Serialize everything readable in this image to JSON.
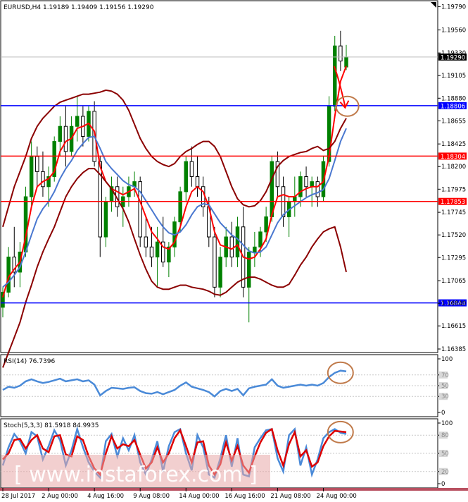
{
  "chart_data": [
    {
      "type": "candlestick",
      "title": "EURUSD,H4  1.19189 1.19409 1.19156 1.19290",
      "symbol": "EURUSD,H4",
      "ohlc": {
        "open": 1.19189,
        "high": 1.19409,
        "low": 1.19156,
        "close": 1.1929
      },
      "ylim": [
        1.1635,
        1.1985
      ],
      "y_ticks": [
        "1.19790",
        "1.19560",
        "1.19330",
        "1.19105",
        "1.18880",
        "1.18655",
        "1.18425",
        "1.18200",
        "1.17975",
        "1.17745",
        "1.17520",
        "1.17295",
        "1.17065",
        "1.16840",
        "1.16615",
        "1.16385"
      ],
      "current_price": {
        "value": 1.1929,
        "label": "1.19290",
        "color": "#000000"
      },
      "levels": [
        {
          "value": 1.18806,
          "label": "1.18806",
          "color": "#0000ff"
        },
        {
          "value": 1.18304,
          "label": "1.18304",
          "color": "#ff0000"
        },
        {
          "value": 1.17853,
          "label": "1.17853",
          "color": "#ff0000"
        },
        {
          "value": 1.16844,
          "label": "1.16844",
          "color": "#0000ff"
        }
      ],
      "x_labels": [
        "28 Jul 2017",
        "2 Aug 00:00",
        "4 Aug 16:00",
        "9 Aug 08:00",
        "14 Aug 00:00",
        "16 Aug 16:00",
        "21 Aug 08:00",
        "24 Aug 00:00"
      ],
      "series": [
        {
          "kind": "candles",
          "color_up": "#008000",
          "color_down": "#000000",
          "values": [
            [
              1.168,
              1.17,
              1.167,
              1.1695
            ],
            [
              1.1695,
              1.174,
              1.169,
              1.173
            ],
            [
              1.173,
              1.176,
              1.17,
              1.1715
            ],
            [
              1.1715,
              1.1745,
              1.17,
              1.1735
            ],
            [
              1.1735,
              1.18,
              1.173,
              1.179
            ],
            [
              1.179,
              1.1845,
              1.178,
              1.183
            ],
            [
              1.183,
              1.184,
              1.18,
              1.1815
            ],
            [
              1.1815,
              1.1835,
              1.179,
              1.18
            ],
            [
              1.18,
              1.182,
              1.178,
              1.181
            ],
            [
              1.181,
              1.185,
              1.1805,
              1.1845
            ],
            [
              1.1845,
              1.187,
              1.183,
              1.186
            ],
            [
              1.186,
              1.188,
              1.182,
              1.1835
            ],
            [
              1.1835,
              1.187,
              1.183,
              1.186
            ],
            [
              1.186,
              1.189,
              1.1845,
              1.187
            ],
            [
              1.187,
              1.188,
              1.184,
              1.185
            ],
            [
              1.185,
              1.188,
              1.1845,
              1.1875
            ],
            [
              1.1875,
              1.1885,
              1.182,
              1.1825
            ],
            [
              1.1825,
              1.183,
              1.173,
              1.175
            ],
            [
              1.175,
              1.179,
              1.174,
              1.1785
            ],
            [
              1.1785,
              1.181,
              1.1775,
              1.18
            ],
            [
              1.18,
              1.181,
              1.177,
              1.178
            ],
            [
              1.178,
              1.18,
              1.176,
              1.179
            ],
            [
              1.179,
              1.181,
              1.178,
              1.18
            ],
            [
              1.18,
              1.1815,
              1.179,
              1.1805
            ],
            [
              1.1805,
              1.181,
              1.174,
              1.175
            ],
            [
              1.175,
              1.177,
              1.173,
              1.174
            ],
            [
              1.174,
              1.176,
              1.172,
              1.173
            ],
            [
              1.173,
              1.176,
              1.17,
              1.1745
            ],
            [
              1.1745,
              1.177,
              1.172,
              1.1725
            ],
            [
              1.1725,
              1.1745,
              1.171,
              1.174
            ],
            [
              1.174,
              1.177,
              1.173,
              1.1765
            ],
            [
              1.1765,
              1.18,
              1.1755,
              1.1795
            ],
            [
              1.1795,
              1.183,
              1.1785,
              1.1825
            ],
            [
              1.1825,
              1.184,
              1.18,
              1.181
            ],
            [
              1.181,
              1.183,
              1.179,
              1.18
            ],
            [
              1.18,
              1.181,
              1.177,
              1.178
            ],
            [
              1.178,
              1.179,
              1.174,
              1.175
            ],
            [
              1.175,
              1.176,
              1.169,
              1.17
            ],
            [
              1.17,
              1.174,
              1.169,
              1.173
            ],
            [
              1.173,
              1.176,
              1.172,
              1.175
            ],
            [
              1.175,
              1.1765,
              1.172,
              1.173
            ],
            [
              1.173,
              1.177,
              1.172,
              1.176
            ],
            [
              1.176,
              1.178,
              1.169,
              1.17
            ],
            [
              1.17,
              1.174,
              1.1665,
              1.1735
            ],
            [
              1.1735,
              1.1755,
              1.172,
              1.174
            ],
            [
              1.174,
              1.176,
              1.173,
              1.1755
            ],
            [
              1.1755,
              1.178,
              1.1745,
              1.177
            ],
            [
              1.177,
              1.183,
              1.1765,
              1.1825
            ],
            [
              1.1825,
              1.1835,
              1.179,
              1.18
            ],
            [
              1.18,
              1.181,
              1.176,
              1.177
            ],
            [
              1.177,
              1.179,
              1.175,
              1.1785
            ],
            [
              1.1785,
              1.181,
              1.177,
              1.179
            ],
            [
              1.179,
              1.1815,
              1.178,
              1.181
            ],
            [
              1.181,
              1.182,
              1.179,
              1.18
            ],
            [
              1.18,
              1.181,
              1.178,
              1.1805
            ],
            [
              1.1805,
              1.181,
              1.178,
              1.179
            ],
            [
              1.179,
              1.183,
              1.1785,
              1.1825
            ],
            [
              1.1825,
              1.189,
              1.182,
              1.188
            ],
            [
              1.188,
              1.195,
              1.1875,
              1.194
            ],
            [
              1.194,
              1.1955,
              1.1915,
              1.1925
            ],
            [
              1.1919,
              1.1941,
              1.1916,
              1.1929
            ]
          ]
        },
        {
          "kind": "line",
          "color": "#ff0000",
          "role": "fast moving average",
          "values": [
            1.169,
            1.171,
            1.1718,
            1.1725,
            1.175,
            1.178,
            1.18,
            1.1805,
            1.1808,
            1.1815,
            1.1835,
            1.1845,
            1.1848,
            1.1858,
            1.186,
            1.1863,
            1.1855,
            1.182,
            1.1805,
            1.1798,
            1.1795,
            1.1792,
            1.1795,
            1.1798,
            1.1785,
            1.177,
            1.1755,
            1.1748,
            1.174,
            1.1738,
            1.1745,
            1.176,
            1.178,
            1.1795,
            1.18,
            1.1795,
            1.178,
            1.1755,
            1.1742,
            1.174,
            1.1738,
            1.1742,
            1.173,
            1.1728,
            1.173,
            1.1738,
            1.1748,
            1.1772,
            1.179,
            1.1792,
            1.179,
            1.179,
            1.1795,
            1.1798,
            1.18,
            1.18,
            1.1805,
            1.183,
            1.187,
            1.1905,
            1.192
          ]
        },
        {
          "kind": "line",
          "color": "#4a78d0",
          "role": "slow moving average",
          "values": [
            1.17,
            1.1705,
            1.1712,
            1.172,
            1.1735,
            1.1752,
            1.1768,
            1.1778,
            1.1785,
            1.1795,
            1.1808,
            1.1818,
            1.1826,
            1.1836,
            1.1843,
            1.1849,
            1.185,
            1.1838,
            1.1825,
            1.1818,
            1.1812,
            1.1806,
            1.1802,
            1.18,
            1.1795,
            1.1786,
            1.1777,
            1.1768,
            1.176,
            1.1754,
            1.1752,
            1.1755,
            1.1762,
            1.1772,
            1.178,
            1.1783,
            1.1782,
            1.1773,
            1.1764,
            1.1758,
            1.1752,
            1.1748,
            1.1742,
            1.1736,
            1.1734,
            1.1735,
            1.174,
            1.1752,
            1.1764,
            1.1772,
            1.1777,
            1.1781,
            1.1785,
            1.1789,
            1.1792,
            1.1794,
            1.1797,
            1.1808,
            1.1826,
            1.1845,
            1.1858
          ]
        },
        {
          "kind": "line",
          "color": "#8b0000",
          "role": "upper band",
          "values": [
            1.176,
            1.178,
            1.18,
            1.1815,
            1.183,
            1.1848,
            1.186,
            1.1868,
            1.1874,
            1.188,
            1.1884,
            1.1886,
            1.1888,
            1.189,
            1.1892,
            1.1892,
            1.1893,
            1.1894,
            1.1896,
            1.1895,
            1.1892,
            1.1886,
            1.1876,
            1.1862,
            1.1848,
            1.1838,
            1.183,
            1.1825,
            1.1822,
            1.182,
            1.1823,
            1.183,
            1.1835,
            1.1838,
            1.1842,
            1.1845,
            1.1845,
            1.184,
            1.183,
            1.1815,
            1.18,
            1.1788,
            1.1782,
            1.178,
            1.1781,
            1.1786,
            1.1795,
            1.1808,
            1.182,
            1.1826,
            1.183,
            1.1832,
            1.1834,
            1.1835,
            1.1838,
            1.184,
            1.1836,
            1.1838,
            1.1845,
            1.1858,
            1.1868
          ]
        },
        {
          "kind": "line",
          "color": "#8b0000",
          "role": "lower band",
          "values": [
            1.162,
            1.1635,
            1.165,
            1.1665,
            1.1685,
            1.1702,
            1.172,
            1.1735,
            1.1748,
            1.176,
            1.1775,
            1.179,
            1.18,
            1.1808,
            1.1814,
            1.1818,
            1.1818,
            1.1812,
            1.1805,
            1.1798,
            1.1788,
            1.1778,
            1.1765,
            1.1748,
            1.1732,
            1.1718,
            1.1706,
            1.17,
            1.1698,
            1.1698,
            1.17,
            1.1702,
            1.1702,
            1.17,
            1.1699,
            1.1698,
            1.1696,
            1.1693,
            1.1692,
            1.1695,
            1.17,
            1.1705,
            1.1708,
            1.171,
            1.171,
            1.1708,
            1.1705,
            1.1702,
            1.17,
            1.17,
            1.1703,
            1.1712,
            1.1722,
            1.173,
            1.174,
            1.1748,
            1.1755,
            1.1758,
            1.176,
            1.174,
            1.1715
          ]
        }
      ],
      "annotations": [
        {
          "type": "arrow",
          "color": "#ff0000",
          "from": [
            58.6,
            1.191
          ],
          "to": [
            59.8,
            1.188
          ]
        },
        {
          "type": "circle",
          "color": "#c07a4a",
          "center": [
            60.2,
            1.188
          ]
        }
      ]
    },
    {
      "type": "line",
      "title": "RSI(14) 76.7396",
      "ylim": [
        0,
        100
      ],
      "y_ticks": [
        "100",
        "70",
        "50",
        "30",
        "0"
      ],
      "guide_lines": [
        70,
        50,
        30
      ],
      "series": [
        {
          "color": "#4a8ad8",
          "values": [
            42,
            48,
            46,
            50,
            58,
            62,
            58,
            55,
            57,
            60,
            63,
            58,
            60,
            62,
            58,
            60,
            52,
            32,
            40,
            46,
            45,
            44,
            46,
            47,
            40,
            36,
            35,
            38,
            34,
            38,
            42,
            50,
            56,
            48,
            45,
            42,
            38,
            30,
            40,
            44,
            40,
            44,
            32,
            45,
            48,
            50,
            52,
            62,
            50,
            46,
            48,
            50,
            52,
            50,
            52,
            50,
            55,
            66,
            74,
            78,
            76.7
          ]
        }
      ],
      "annotations": [
        {
          "type": "circle",
          "color": "#c07a4a",
          "center": [
            58.5,
            74
          ]
        }
      ]
    },
    {
      "type": "line",
      "title": "Stoch(5,3,3) 81.5918 84.9935",
      "ylim": [
        0,
        100
      ],
      "y_ticks": [
        "100",
        "80",
        "50",
        "20",
        "0"
      ],
      "guide_lines": [
        80,
        50,
        20
      ],
      "series": [
        {
          "color": "#4a8ad8",
          "role": "%K",
          "values": [
            30,
            60,
            82,
            70,
            50,
            85,
            78,
            40,
            62,
            88,
            72,
            30,
            55,
            90,
            60,
            35,
            20,
            10,
            70,
            82,
            45,
            75,
            55,
            80,
            35,
            15,
            40,
            70,
            20,
            62,
            85,
            90,
            50,
            22,
            80,
            60,
            15,
            10,
            42,
            80,
            28,
            75,
            15,
            12,
            60,
            75,
            88,
            90,
            42,
            20,
            80,
            90,
            30,
            60,
            15,
            40,
            75,
            85,
            90,
            84,
            82
          ]
        },
        {
          "color": "#dd0000",
          "role": "%D",
          "values": [
            40,
            50,
            72,
            74,
            58,
            72,
            80,
            58,
            52,
            78,
            80,
            48,
            45,
            78,
            72,
            45,
            25,
            15,
            50,
            78,
            58,
            65,
            62,
            72,
            48,
            25,
            35,
            60,
            35,
            50,
            75,
            88,
            62,
            35,
            68,
            70,
            30,
            15,
            32,
            68,
            38,
            62,
            30,
            18,
            45,
            68,
            84,
            90,
            55,
            30,
            65,
            85,
            45,
            55,
            28,
            35,
            62,
            78,
            87,
            86,
            85
          ]
        }
      ],
      "annotations": [
        {
          "type": "circle",
          "color": "#c07a4a",
          "center": [
            58.5,
            85
          ]
        }
      ]
    }
  ],
  "watermark": {
    "text": "[ www.instaforex.com ]",
    "color": "#f0c8c8"
  },
  "bottom_bar_color": "#b85060"
}
